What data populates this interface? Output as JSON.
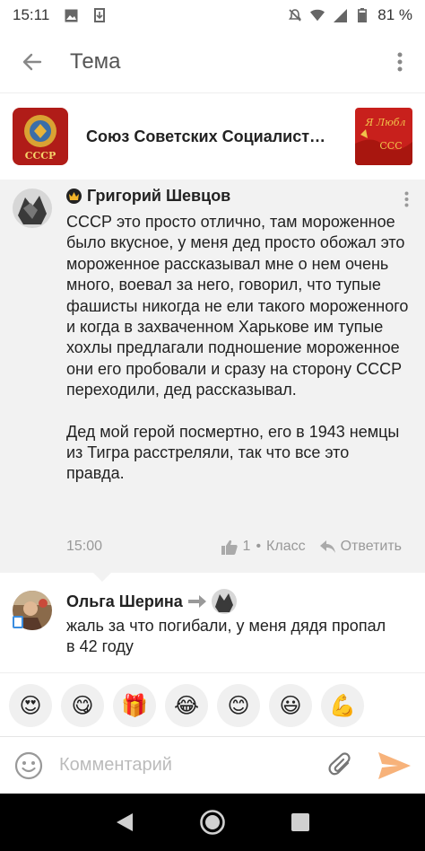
{
  "status_bar": {
    "time": "15:11",
    "battery": "81 %"
  },
  "app_bar": {
    "title": "Тема"
  },
  "group": {
    "name": "Союз Советских Социалист…",
    "avatar_text": "СССР",
    "cover_text_top": "Я Любл",
    "cover_text_bottom": "ССС"
  },
  "post": {
    "author": "Григорий Шевцов",
    "paragraphs": [
      "СССР это просто отлично, там мороженное было вкусное, у меня дед просто обожал это мороженное рассказывал мне о нем очень много, воевал за него, говорил, что тупые фашисты никогда не ели такого мороженного и когда в захваченном Харькове им тупые хохлы предлагали подношение мороженное они его пробовали и сразу на сторону СССР переходили, дед рассказывал.",
      "Дед мой герой посмертно, его в 1943 немцы из Тигра расстреляли, так что все это правда."
    ],
    "time": "15:00",
    "likes": "1",
    "separator": "•",
    "like_label": "Класс",
    "reply_label": "Ответить"
  },
  "reply": {
    "author": "Ольга Шерина",
    "text": "жаль за что погибали, у меня дядя пропал в 42 году"
  },
  "reactions": [
    {
      "name": "heart-eyes",
      "glyph": "😍"
    },
    {
      "name": "yum",
      "glyph": "😋"
    },
    {
      "name": "gift",
      "glyph": "🎁"
    },
    {
      "name": "laugh-tears",
      "glyph": "😂"
    },
    {
      "name": "smile",
      "glyph": "😊"
    },
    {
      "name": "grin",
      "glyph": "😃"
    },
    {
      "name": "flexed-biceps",
      "glyph": "💪"
    }
  ],
  "comment_bar": {
    "placeholder": "Комментарий"
  },
  "colors": {
    "post_bg": "#f2f2f2",
    "muted": "#999999",
    "send_accent": "#f7b27a",
    "soviet_red": "#c8201c",
    "gold": "#e8b43a"
  }
}
